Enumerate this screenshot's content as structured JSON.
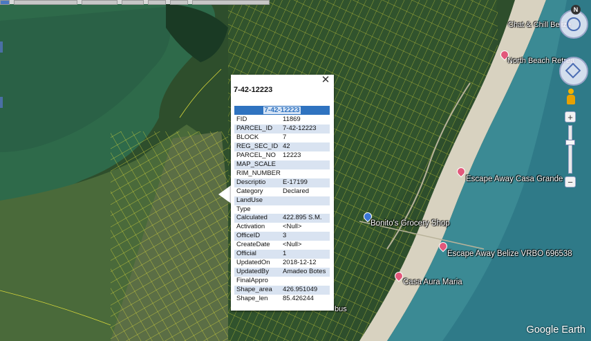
{
  "popup": {
    "title": "7-42-12223",
    "header": "7-42-12223",
    "rows": [
      {
        "key": "FID",
        "value": "11869"
      },
      {
        "key": "PARCEL_ID",
        "value": "7-42-12223"
      },
      {
        "key": "BLOCK",
        "value": "7"
      },
      {
        "key": "REG_SEC_ID",
        "value": "42"
      },
      {
        "key": "PARCEL_NO",
        "value": "12223"
      },
      {
        "key": "MAP_SCALE",
        "value": ""
      },
      {
        "key": "RIM_NUMBER",
        "value": ""
      },
      {
        "key": "Descriptio",
        "value": "E-17199"
      },
      {
        "key": "Category",
        "value": "Declared"
      },
      {
        "key": "LandUse",
        "value": ""
      },
      {
        "key": "Type",
        "value": ""
      },
      {
        "key": "Calculated",
        "value": "422.895 S.M."
      },
      {
        "key": "Activation",
        "value": "<Null>"
      },
      {
        "key": "OfficeID",
        "value": "3"
      },
      {
        "key": "CreateDate",
        "value": "<Null>"
      },
      {
        "key": "Official",
        "value": "1"
      },
      {
        "key": "UpdatedOn",
        "value": "2018-12-12"
      },
      {
        "key": "UpdatedBy",
        "value": "Amadeo Botes"
      },
      {
        "key": "FinalAppro",
        "value": ""
      },
      {
        "key": "Shape_area",
        "value": "426.951049"
      },
      {
        "key": "Shape_len",
        "value": "85.426244"
      }
    ]
  },
  "places": {
    "chat_chill": "Chat & Chill Belize",
    "north_beach": "North Beach Retrea",
    "escape_away_casa": "Escape Away Casa Grande",
    "bonitos": "Bonito's Grocery Shop",
    "escape_away_vrbo": "Escape Away Belize VRBO 696538",
    "casa_aura": "Casa Aura Maria",
    "bus": "bus"
  },
  "branding": {
    "logo": "Google Earth"
  },
  "controls": {
    "compass_north": "N",
    "zoom_in": "+",
    "zoom_out": "−"
  },
  "colors": {
    "parcel_lines": "#e8e84a",
    "popup_header": "#2f73c0",
    "row_alt": "#d9e3f1",
    "pin": "#e2587b"
  }
}
